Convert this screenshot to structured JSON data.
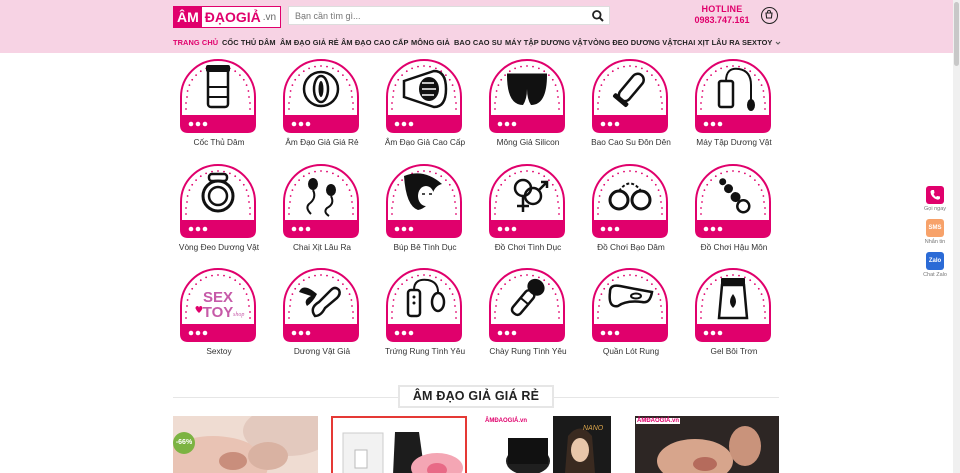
{
  "header": {
    "logo": {
      "part1": "ÂM",
      "part2": "ĐẠOGIẢ",
      "part3": ".vn"
    },
    "search_placeholder": "Bạn cần tìm gì...",
    "hotline_label": "HOTLINE",
    "hotline_number": "0983.747.161"
  },
  "nav": {
    "items": [
      "TRANG CHỦ",
      "CỐC THỦ DÂM",
      "ÂM ĐẠO GIẢ RẺ",
      "ÂM ĐẠO CAO CẤP",
      "MÔNG GIẢ",
      "BAO CAO SU",
      "MÁY TẬP DƯƠNG VẬT",
      "VÒNG ĐEO DƯƠNG VẬT",
      "CHAI XỊT LÂU RA",
      "SEXTOY"
    ]
  },
  "categories": [
    {
      "label": "Cốc Thủ Dâm",
      "icon": "masturbator-cup-icon"
    },
    {
      "label": "Âm Đạo Giả Giá Rẻ",
      "icon": "vagina-icon"
    },
    {
      "label": "Âm Đạo Giả Cao Cấp",
      "icon": "premium-vagina-icon"
    },
    {
      "label": "Mông Giả Silicon",
      "icon": "buttocks-icon"
    },
    {
      "label": "Bao Cao Su Đôn Dên",
      "icon": "condom-icon"
    },
    {
      "label": "Máy Tập Dương Vật",
      "icon": "pump-icon"
    },
    {
      "label": "Vòng Đeo Dương Vật",
      "icon": "ring-icon"
    },
    {
      "label": "Chai Xịt Lâu Ra",
      "icon": "sperm-icon"
    },
    {
      "label": "Búp Bê Tình Dục",
      "icon": "doll-icon"
    },
    {
      "label": "Đồ Chơi Tình Dục",
      "icon": "gender-icon"
    },
    {
      "label": "Đồ Chơi Bạo Dâm",
      "icon": "handcuffs-icon"
    },
    {
      "label": "Đồ Chơi Hậu Môn",
      "icon": "anal-beads-icon"
    },
    {
      "label": "Sextoy",
      "icon": "sextoy-logo-icon",
      "logo_text": [
        "SEX",
        "TOY",
        "shop"
      ]
    },
    {
      "label": "Dương Vật Giả",
      "icon": "winged-dildo-icon"
    },
    {
      "label": "Trứng Rung Tình Yêu",
      "icon": "vibrating-egg-icon"
    },
    {
      "label": "Chày Rung Tình Yêu",
      "icon": "wand-icon"
    },
    {
      "label": "Quần Lót Rung",
      "icon": "panty-icon"
    },
    {
      "label": "Gel Bôi Trơn",
      "icon": "lubricant-icon"
    }
  ],
  "section": {
    "title": "ÂM ĐẠO GIẢ GIÁ RẺ"
  },
  "products": [
    {
      "badge": "-66%",
      "brand": ""
    },
    {
      "badge": "",
      "brand": ""
    },
    {
      "badge": "",
      "brand": "ÂMĐAOGIẢ.vn"
    },
    {
      "badge": "",
      "brand": "ÂMĐAOGIẢ.vn"
    }
  ],
  "contacts": [
    {
      "label": "Gọi ngay",
      "icon": "phone-icon",
      "btn_text": ""
    },
    {
      "label": "Nhắn tin",
      "icon": "sms-icon",
      "btn_text": "SMS"
    },
    {
      "label": "Chat Zalo",
      "icon": "zalo-icon",
      "btn_text": "Zalo"
    }
  ],
  "colors": {
    "brand": "#e0006c",
    "header_bg": "#f7d3e4"
  }
}
